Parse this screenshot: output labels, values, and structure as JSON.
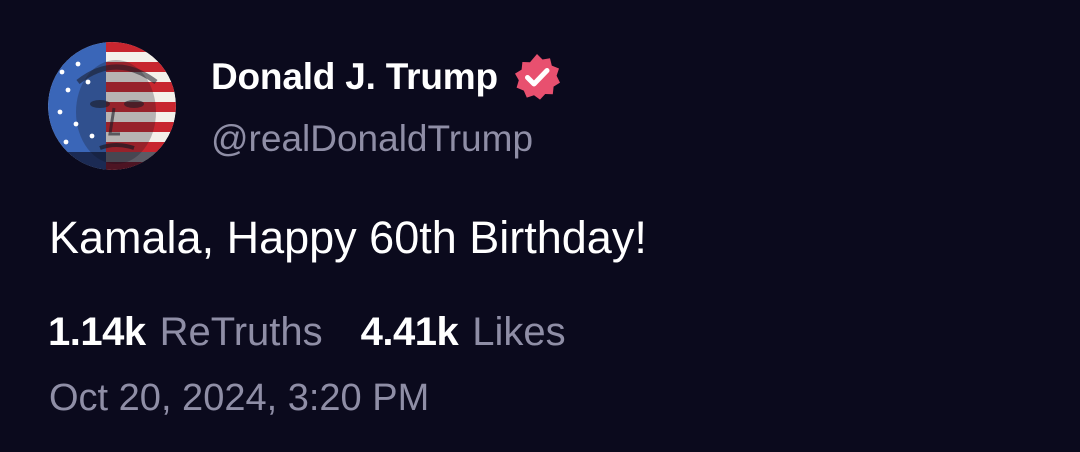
{
  "post": {
    "author": {
      "display_name": "Donald J. Trump",
      "handle": "@realDonaldTrump",
      "verified": true,
      "verified_icon": "verified-badge-icon",
      "avatar": "flag-portrait-avatar"
    },
    "text": "Kamala, Happy 60th Birthday!",
    "stats": {
      "retruths_count": "1.14k",
      "retruths_label": "ReTruths",
      "likes_count": "4.41k",
      "likes_label": "Likes"
    },
    "timestamp": "Oct 20, 2024, 3:20 PM"
  },
  "colors": {
    "background": "#0b0a1d",
    "primary_text": "#ffffff",
    "secondary_text": "#8f8ea6",
    "verified_badge": "#e8506f"
  }
}
